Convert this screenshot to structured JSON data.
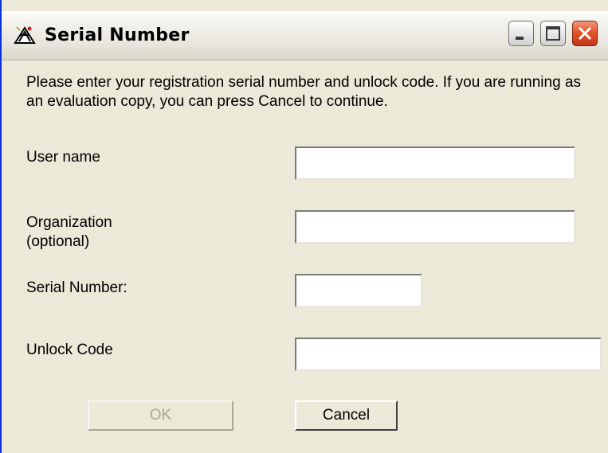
{
  "window": {
    "title": "Serial Number",
    "icon": "serial-key-app-icon",
    "controls": {
      "minimize": "minimize-icon",
      "maximize": "maximize-icon",
      "close": "close-icon"
    }
  },
  "dialog": {
    "prompt": "Please enter your registration serial number and unlock code. If you are running as an evaluation copy, you can press Cancel to continue.",
    "fields": {
      "user_name": {
        "label": "User name",
        "value": ""
      },
      "organization": {
        "label_line1": "Organization",
        "label_line2": "(optional)",
        "value": ""
      },
      "serial_number": {
        "label": "Serial Number:",
        "value": ""
      },
      "unlock_code": {
        "label": "Unlock Code",
        "value": ""
      }
    },
    "buttons": {
      "ok": {
        "label": "OK",
        "enabled": false
      },
      "cancel": {
        "label": "Cancel",
        "enabled": true
      }
    }
  }
}
